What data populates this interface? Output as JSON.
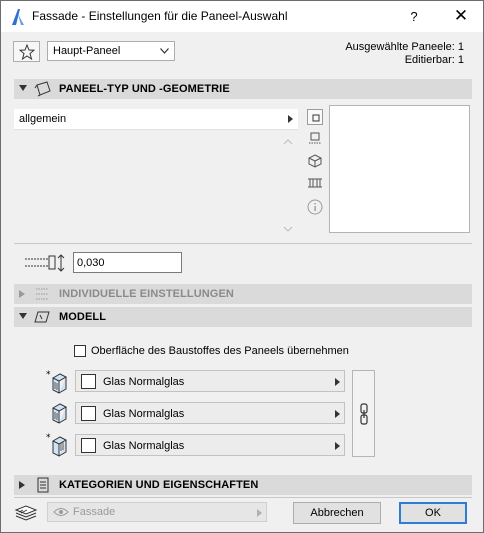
{
  "window": {
    "title": "Fassade - Einstellungen für die Paneel-Auswahl",
    "help_glyph": "?",
    "close_glyph": "✕",
    "app_icon": "archicad-icon"
  },
  "toolbar": {
    "favorites_icon": "star-icon",
    "dropdown_value": "Haupt-Paneel",
    "selected_label": "Ausgewählte Paneele: 1",
    "editable_label": "Editierbar: 1"
  },
  "sections": {
    "geometry": {
      "title": "PANEEL-TYP UND -GEOMETRIE",
      "expanded": true
    },
    "individual": {
      "title": "INDIVIDUELLE EINSTELLUNGEN",
      "expanded": false,
      "enabled": false
    },
    "model": {
      "title": "MODELL",
      "expanded": true
    },
    "categories": {
      "title": "KATEGORIEN UND EIGENSCHAFTEN",
      "expanded": false
    }
  },
  "geometry": {
    "selected_type": "allgemein",
    "view_buttons": [
      "plan-view-icon",
      "elevation-view-icon",
      "3d-view-icon",
      "section-view-icon",
      "info-icon"
    ],
    "thickness": "0,030"
  },
  "model": {
    "override_label": "Oberfläche des Baustoffes des Paneels übernehmen",
    "override_checked": false,
    "materials": [
      {
        "label": "Glas Normalglas",
        "icon": "panel-outer-face-icon"
      },
      {
        "label": "Glas Normalglas",
        "icon": "panel-edge-icon"
      },
      {
        "label": "Glas Normalglas",
        "icon": "panel-inner-face-icon"
      }
    ],
    "chain_icon": "chain-link-icon"
  },
  "footer": {
    "layer_value": "Fassade",
    "cancel_label": "Abbrechen",
    "ok_label": "OK",
    "ok_accent": "#2d7dd2"
  }
}
